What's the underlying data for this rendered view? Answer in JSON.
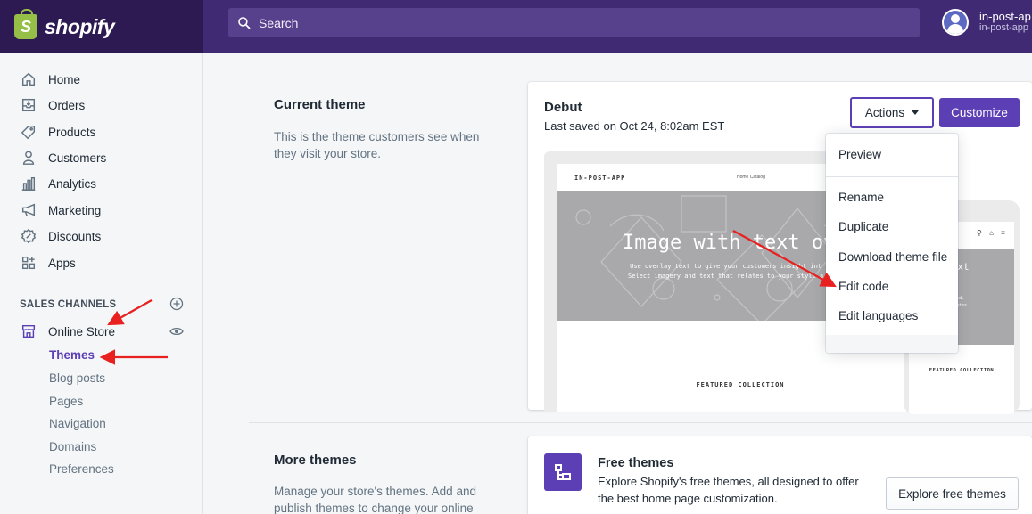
{
  "brand": {
    "name": "shopify",
    "color": "#95bf47"
  },
  "search": {
    "placeholder": "Search"
  },
  "user": {
    "name": "in-post-ap",
    "store": "in-post-app"
  },
  "nav": [
    {
      "label": "Home",
      "icon": "home-icon"
    },
    {
      "label": "Orders",
      "icon": "orders-icon"
    },
    {
      "label": "Products",
      "icon": "tag-icon"
    },
    {
      "label": "Customers",
      "icon": "person-icon"
    },
    {
      "label": "Analytics",
      "icon": "bar-chart-icon"
    },
    {
      "label": "Marketing",
      "icon": "megaphone-icon"
    },
    {
      "label": "Discounts",
      "icon": "discount-icon"
    },
    {
      "label": "Apps",
      "icon": "apps-icon"
    }
  ],
  "sales_channels": {
    "heading": "SALES CHANNELS",
    "channel": "Online Store",
    "sub_items": [
      "Themes",
      "Blog posts",
      "Pages",
      "Navigation",
      "Domains",
      "Preferences"
    ],
    "active": "Themes"
  },
  "current_theme": {
    "title": "Current theme",
    "description_1": "This is the theme customers see when",
    "description_2": "they visit your store.",
    "theme_name": "Debut",
    "last_saved": "Last saved on Oct 24, 8:02am EST",
    "actions_label": "Actions",
    "customize_label": "Customize"
  },
  "preview": {
    "logo": "IN-POST-APP",
    "menu": "Home    Catalog",
    "hero_title": "Image with text ove",
    "hero_sub_1": "Use overlay text to give your customers insight int",
    "hero_sub_2": "Select imagery and text that relates to your style a",
    "featured": "FEATURED COLLECTION",
    "mobile_icons": "⚲ ⌂ ≡",
    "mobile_title_1": "with text",
    "mobile_title_2": "erlay",
    "mobile_sub_1": "ext to give your",
    "mobile_sub_2": "t into your brand.",
    "mobile_sub_3": "d text that relates",
    "mobile_sub_4": "e and story.",
    "mobile_featured": "FEATURED COLLECTION"
  },
  "actions_menu": {
    "items": [
      "Preview",
      "Rename",
      "Duplicate",
      "Download theme file",
      "Edit code",
      "Edit languages"
    ]
  },
  "more_themes": {
    "title": "More themes",
    "description_1": "Manage your store's themes. Add and",
    "description_2": "publish themes to change your online",
    "free_title": "Free themes",
    "free_desc_1": "Explore Shopify's free themes, all designed to offer",
    "free_desc_2": "the best home page customization.",
    "explore_label": "Explore free themes"
  },
  "colors": {
    "accent": "#5c3fb5",
    "topbar": "#3f2a73",
    "annotation": "#e8201f"
  }
}
